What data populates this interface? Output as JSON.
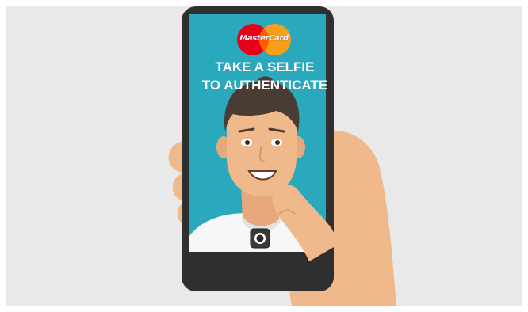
{
  "brand": {
    "logo_text": "MasterCard",
    "colors": {
      "red": "#eb001b",
      "orange": "#f79e1b"
    }
  },
  "headline": {
    "line1": "TAKE A SELFIE",
    "line2": "TO AUTHENTICATE"
  },
  "camera": {
    "shutter_icon": "camera-shutter-icon"
  },
  "colors": {
    "background": "#e9e9e9",
    "phone_body": "#2f2f2f",
    "screen": "#2aa9bd",
    "skin": "#f0b98b",
    "hair": "#4a3b34",
    "shirt": "#f7f7f7"
  }
}
